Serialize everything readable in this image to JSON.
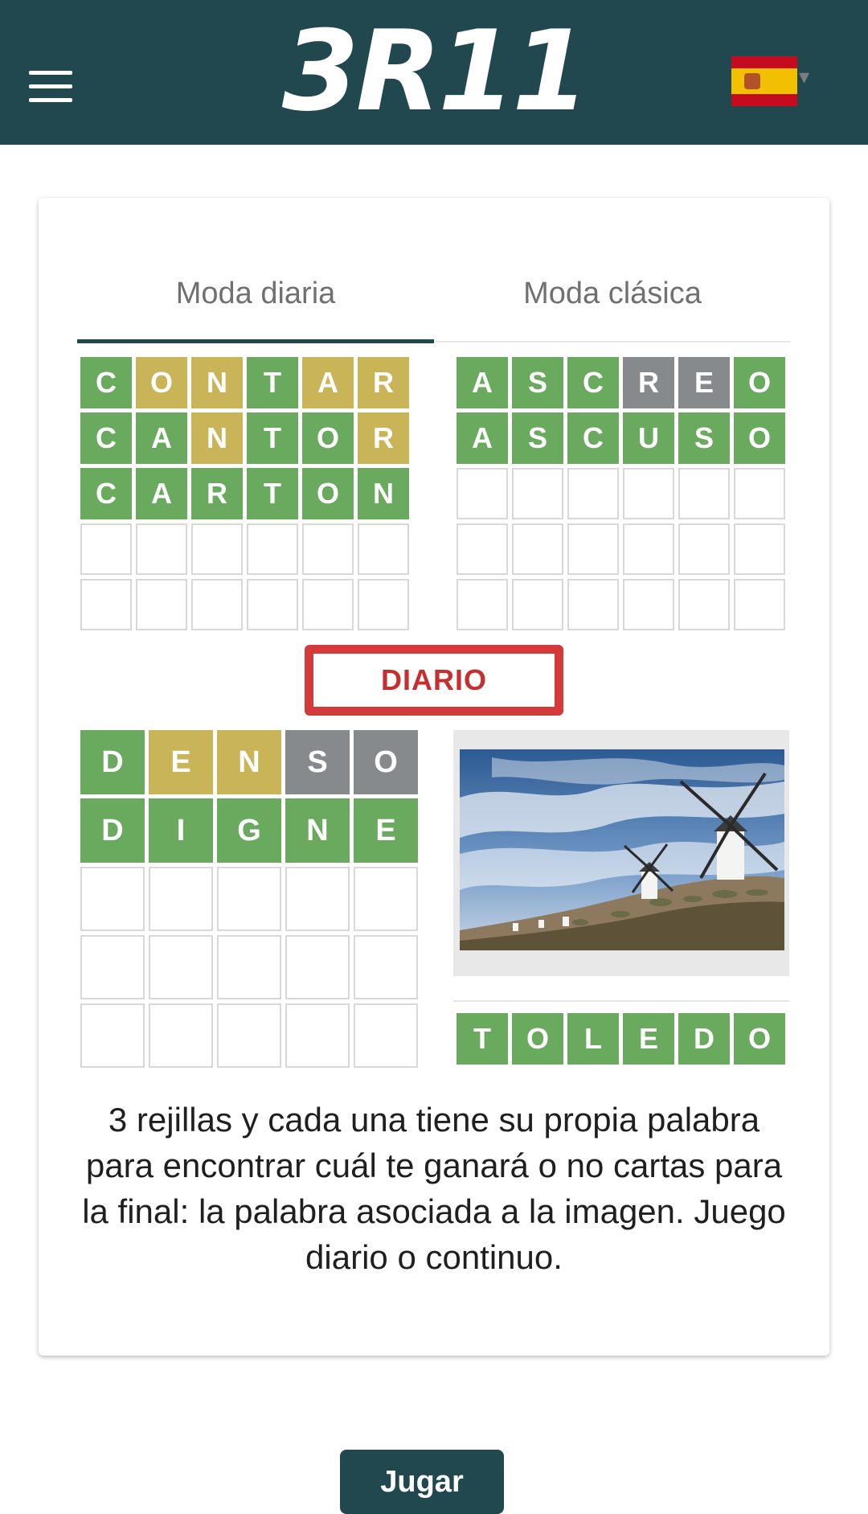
{
  "header": {
    "logo": "3R11",
    "menu_icon": "hamburger-menu-icon",
    "language_flag": "spain-flag-icon",
    "caret": "▾"
  },
  "tabs": [
    {
      "label": "Moda diaria",
      "active": true
    },
    {
      "label": "Moda clásica",
      "active": false
    }
  ],
  "grid1": {
    "rows": [
      [
        [
          "C",
          "g"
        ],
        [
          "O",
          "y"
        ],
        [
          "N",
          "y"
        ],
        [
          "T",
          "g"
        ],
        [
          "A",
          "y"
        ],
        [
          "R",
          "y"
        ]
      ],
      [
        [
          "C",
          "g"
        ],
        [
          "A",
          "g"
        ],
        [
          "N",
          "y"
        ],
        [
          "T",
          "g"
        ],
        [
          "O",
          "g"
        ],
        [
          "R",
          "y"
        ]
      ],
      [
        [
          "C",
          "g"
        ],
        [
          "A",
          "g"
        ],
        [
          "R",
          "g"
        ],
        [
          "T",
          "g"
        ],
        [
          "O",
          "g"
        ],
        [
          "N",
          "g"
        ]
      ],
      [
        [
          "",
          ""
        ],
        [
          "",
          ""
        ],
        [
          "",
          ""
        ],
        [
          "",
          ""
        ],
        [
          "",
          ""
        ],
        [
          "",
          ""
        ]
      ],
      [
        [
          "",
          ""
        ],
        [
          "",
          ""
        ],
        [
          "",
          ""
        ],
        [
          "",
          ""
        ],
        [
          "",
          ""
        ],
        [
          "",
          ""
        ]
      ]
    ]
  },
  "grid2": {
    "rows": [
      [
        [
          "A",
          "g"
        ],
        [
          "S",
          "g"
        ],
        [
          "C",
          "g"
        ],
        [
          "R",
          "x"
        ],
        [
          "E",
          "x"
        ],
        [
          "O",
          "g"
        ]
      ],
      [
        [
          "A",
          "g"
        ],
        [
          "S",
          "g"
        ],
        [
          "C",
          "g"
        ],
        [
          "U",
          "g"
        ],
        [
          "S",
          "g"
        ],
        [
          "O",
          "g"
        ]
      ],
      [
        [
          "",
          ""
        ],
        [
          "",
          ""
        ],
        [
          "",
          ""
        ],
        [
          "",
          ""
        ],
        [
          "",
          ""
        ],
        [
          "",
          ""
        ]
      ],
      [
        [
          "",
          ""
        ],
        [
          "",
          ""
        ],
        [
          "",
          ""
        ],
        [
          "",
          ""
        ],
        [
          "",
          ""
        ],
        [
          "",
          ""
        ]
      ],
      [
        [
          "",
          ""
        ],
        [
          "",
          ""
        ],
        [
          "",
          ""
        ],
        [
          "",
          ""
        ],
        [
          "",
          ""
        ],
        [
          "",
          ""
        ]
      ]
    ]
  },
  "stamp": "DIARIO",
  "grid3": {
    "rows": [
      [
        [
          "D",
          "g"
        ],
        [
          "E",
          "y"
        ],
        [
          "N",
          "y"
        ],
        [
          "S",
          "x"
        ],
        [
          "O",
          "x"
        ]
      ],
      [
        [
          "D",
          "g"
        ],
        [
          "I",
          "g"
        ],
        [
          "G",
          "g"
        ],
        [
          "N",
          "g"
        ],
        [
          "E",
          "g"
        ]
      ],
      [
        [
          "",
          ""
        ],
        [
          "",
          ""
        ],
        [
          "",
          ""
        ],
        [
          "",
          ""
        ],
        [
          "",
          ""
        ]
      ],
      [
        [
          "",
          ""
        ],
        [
          "",
          ""
        ],
        [
          "",
          ""
        ],
        [
          "",
          ""
        ],
        [
          "",
          ""
        ]
      ],
      [
        [
          "",
          ""
        ],
        [
          "",
          ""
        ],
        [
          "",
          ""
        ],
        [
          "",
          ""
        ],
        [
          "",
          ""
        ]
      ]
    ]
  },
  "image_grid": {
    "rows": [
      [
        [
          "T",
          "g"
        ],
        [
          "O",
          "g"
        ],
        [
          "L",
          "g"
        ],
        [
          "E",
          "g"
        ],
        [
          "D",
          "g"
        ],
        [
          "O",
          "g"
        ]
      ]
    ]
  },
  "description": "3 rejillas y cada una tiene su propia palabra para encontrar cuál te ganará o no cartas para la final: la palabra asociada a la imagen. Juego diario o continuo.",
  "play_button": "Jugar",
  "colors": {
    "header": "#21474f",
    "green": "#6aaa5e",
    "yellow": "#c9b458",
    "gray": "#878a8c",
    "stamp_red": "#d43a3a"
  }
}
